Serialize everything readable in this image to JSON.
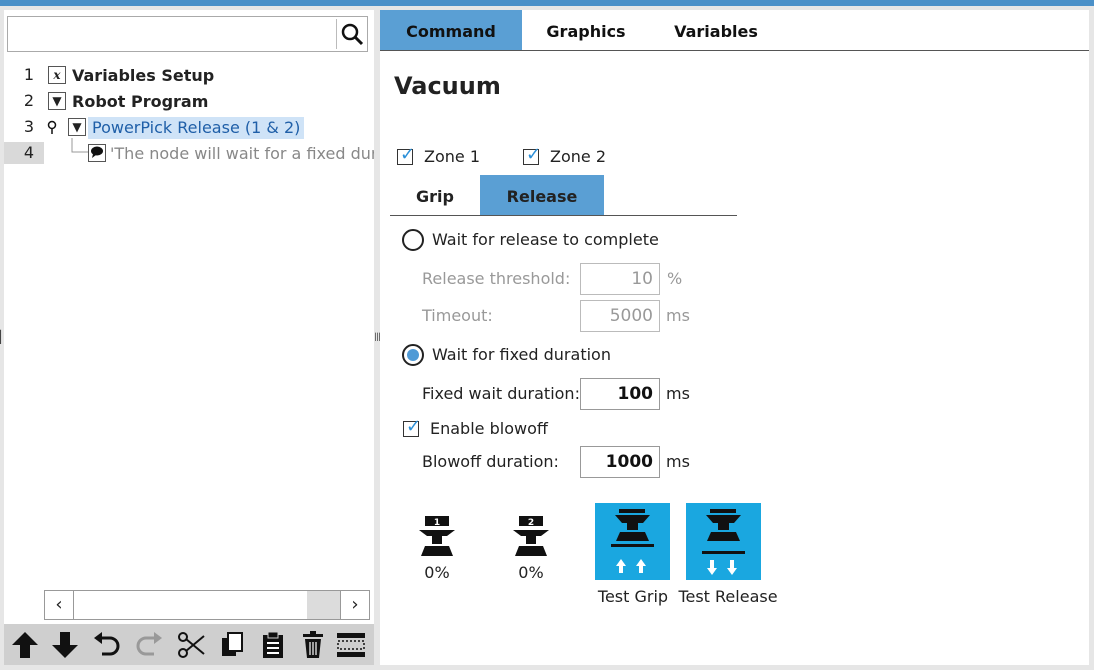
{
  "search": {
    "placeholder": "",
    "icon": "search-icon"
  },
  "tree": [
    {
      "line": "1",
      "icon": "x-variable-icon",
      "icon_glyph": "x",
      "text": "Variables Setup"
    },
    {
      "line": "2",
      "icon": "collapse-triangle-icon",
      "icon_glyph": "▼",
      "text": "Robot Program"
    },
    {
      "line": "3",
      "icon": "collapse-triangle-icon",
      "icon_glyph": "▼",
      "text": "PowerPick Release  (1 & 2)"
    },
    {
      "line": "4",
      "icon": "comment-icon",
      "text": "'The node will wait for a fixed dura"
    }
  ],
  "scroll": {
    "left": "‹",
    "right": "›"
  },
  "toolbar": [
    "move-up-icon",
    "move-down-icon",
    "undo-icon",
    "redo-icon",
    "cut-icon",
    "copy-icon",
    "paste-icon",
    "delete-icon",
    "suppress-icon"
  ],
  "tabs": [
    "Command",
    "Graphics",
    "Variables"
  ],
  "title": "Vacuum",
  "zones": {
    "zone1": "Zone 1",
    "zone2": "Zone 2",
    "zone1_checked": true,
    "zone2_checked": true
  },
  "subtabs": [
    "Grip",
    "Release"
  ],
  "release": {
    "wait_complete_label": "Wait for release to complete",
    "threshold_label": "Release threshold:",
    "threshold_value": "10",
    "threshold_unit": "%",
    "timeout_label": "Timeout:",
    "timeout_value": "5000",
    "timeout_unit": "ms",
    "wait_fixed_label": "Wait for fixed duration",
    "fixed_label": "Fixed wait duration:",
    "fixed_value": "100",
    "fixed_unit": "ms",
    "blowoff_enable_label": "Enable blowoff",
    "blowoff_label": "Blowoff duration:",
    "blowoff_value": "1000",
    "blowoff_unit": "ms"
  },
  "status": {
    "zone1_pct": "0%",
    "zone2_pct": "0%",
    "zone1_num": "1",
    "zone2_num": "2"
  },
  "tests": {
    "grip": "Test Grip",
    "release": "Test Release"
  },
  "colors": {
    "accent": "#5a9fd4",
    "test_button": "#1aa7e0",
    "selection": "#cfe3f7"
  }
}
